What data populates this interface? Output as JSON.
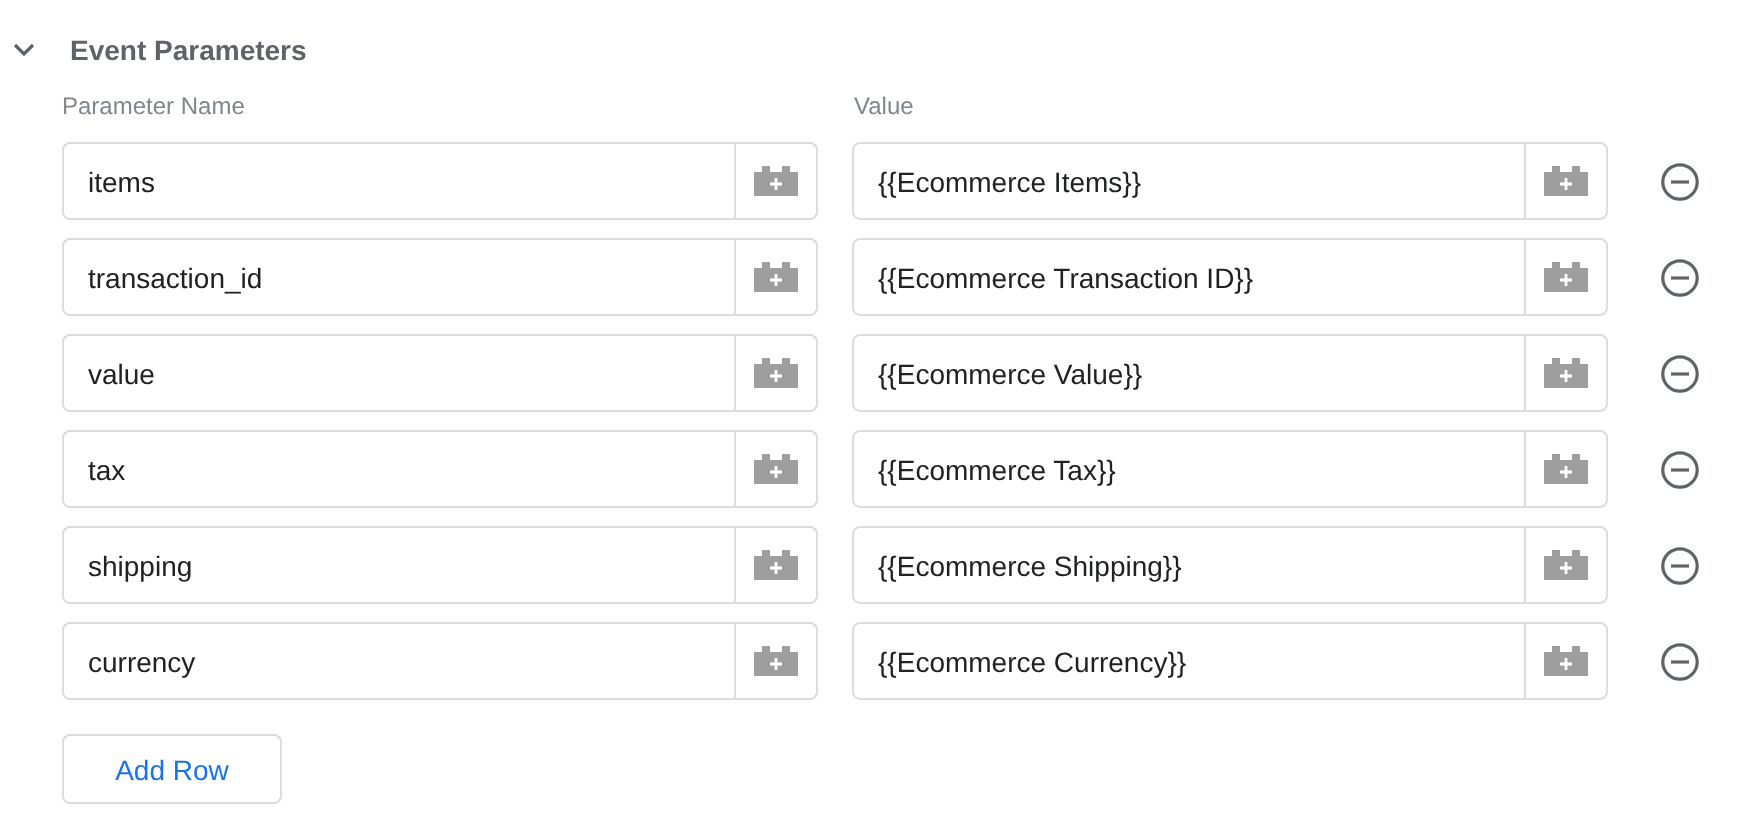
{
  "section": {
    "title": "Event Parameters",
    "expanded": true
  },
  "columns": [
    "Parameter Name",
    "Value"
  ],
  "rows": [
    {
      "name": "items",
      "value": "{{Ecommerce Items}}"
    },
    {
      "name": "transaction_id",
      "value": "{{Ecommerce Transaction ID}}"
    },
    {
      "name": "value",
      "value": "{{Ecommerce Value}}"
    },
    {
      "name": "tax",
      "value": "{{Ecommerce Tax}}"
    },
    {
      "name": "shipping",
      "value": "{{Ecommerce Shipping}}"
    },
    {
      "name": "currency",
      "value": "{{Ecommerce Currency}}"
    }
  ],
  "add_button": "Add Row"
}
